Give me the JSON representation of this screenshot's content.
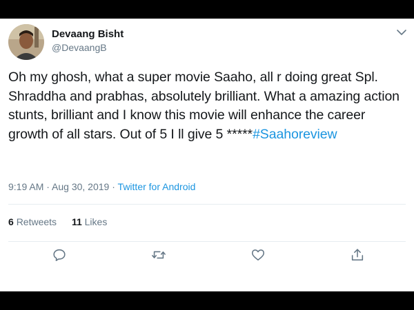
{
  "user": {
    "display_name": "Devaang Bisht",
    "handle": "@DevaangB"
  },
  "tweet": {
    "text": "Oh my ghosh, what a super movie Saaho, all r doing great Spl. Shraddha and prabhas, absolutely brilliant. What a amazing action stunts, brilliant and I know this movie will enhance the career growth of all stars. Out of 5 I ll give 5 *****",
    "hashtag": "#Saahoreview",
    "timestamp": "9:19 AM · Aug 30, 2019",
    "separator": " · ",
    "source": "Twitter for Android"
  },
  "stats": {
    "retweets_count": "6",
    "retweets_label": "Retweets",
    "likes_count": "11",
    "likes_label": "Likes"
  },
  "icons": {
    "reply": "reply-icon",
    "retweet": "retweet-icon",
    "like": "heart-icon",
    "share": "share-icon",
    "menu": "chevron-down-icon"
  },
  "colors": {
    "text": "#14171a",
    "secondary": "#657786",
    "link": "#1b95e0",
    "divider": "#e6ecf0",
    "frame": "#000000"
  }
}
